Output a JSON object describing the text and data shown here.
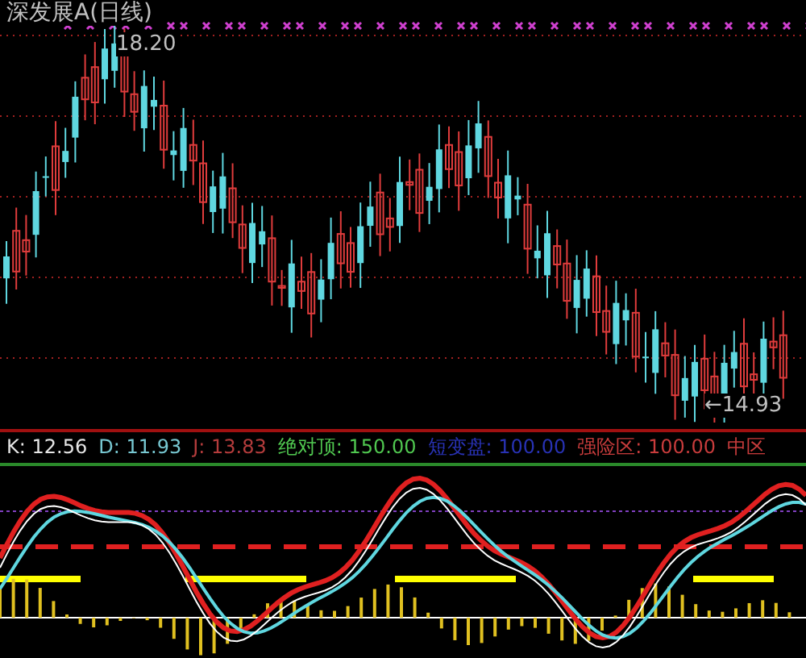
{
  "title": "深发展A(日线)",
  "high_label": "18.20",
  "low_label": "←14.93",
  "indicator": {
    "values": [
      {
        "label": "K:",
        "value": "12.56",
        "kind": "k"
      },
      {
        "label": "D:",
        "value": "11.93",
        "kind": "d"
      },
      {
        "label": "J:",
        "value": "13.83",
        "kind": "j"
      },
      {
        "label": "绝对顶:",
        "value": "150.00",
        "kind": "top"
      },
      {
        "label": "短变盘:",
        "value": "100.00",
        "kind": "turn"
      },
      {
        "label": "强险区:",
        "value": "100.00",
        "kind": "risk"
      }
    ],
    "zone": {
      "text": "中区",
      "kind": "risk"
    }
  }
}
